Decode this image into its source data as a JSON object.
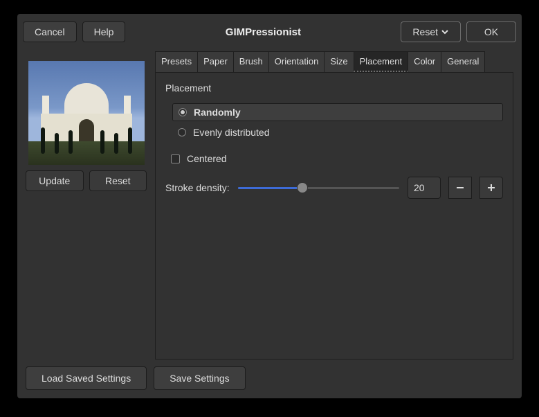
{
  "titlebar": {
    "cancel": "Cancel",
    "help": "Help",
    "title": "GIMPressionist",
    "reset": "Reset",
    "ok": "OK"
  },
  "preview": {
    "update": "Update",
    "reset": "Reset"
  },
  "tabs": [
    "Presets",
    "Paper",
    "Brush",
    "Orientation",
    "Size",
    "Placement",
    "Color",
    "General"
  ],
  "active_tab": "Placement",
  "placement": {
    "section": "Placement",
    "randomly": "Randomly",
    "evenly": "Evenly distributed",
    "centered": "Centered"
  },
  "density": {
    "label": "Stroke density:",
    "value": "20",
    "min": 0,
    "max": 50,
    "percent": 40
  },
  "footer": {
    "load": "Load Saved Settings",
    "save": "Save Settings"
  }
}
